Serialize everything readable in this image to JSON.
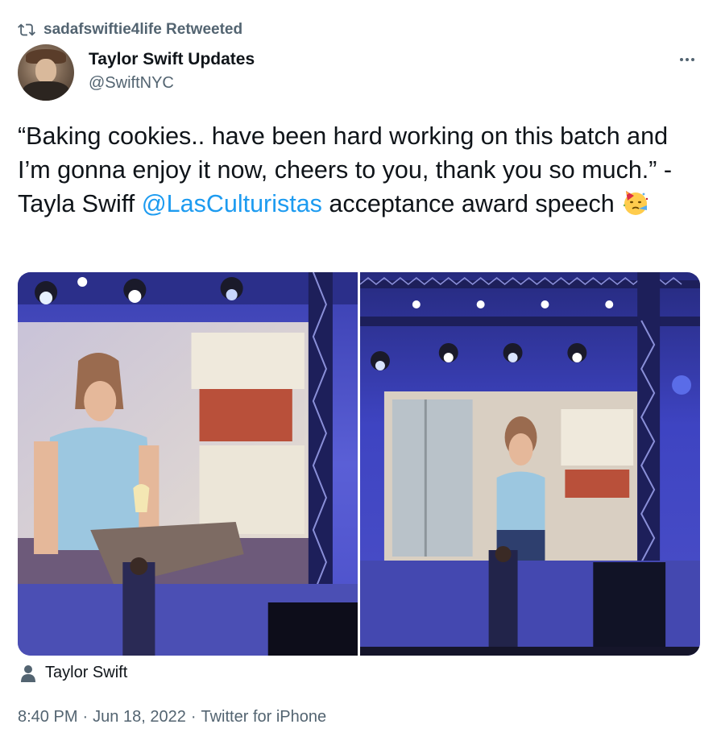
{
  "retweet": {
    "icon": "retweet-icon",
    "text": "sadafswiftie4life Retweeted"
  },
  "author": {
    "avatar_icon": "avatar",
    "name": "Taylor Swift Updates",
    "handle": "@SwiftNYC"
  },
  "more": {
    "icon": "more-horizontal-icon"
  },
  "tweet": {
    "text_before": "“Baking cookies.. have been hard working on this batch and I’m gonna enjoy it now, cheers to you, thank you so much.” - Tayla Swiff ",
    "mention": "@LasCulturistas",
    "text_after": " acceptance award speech ",
    "emoji": "partying-face-emoji"
  },
  "media": {
    "photos": [
      "photo-left",
      "photo-right"
    ]
  },
  "tagged": {
    "icon": "person-icon",
    "name": "Taylor Swift"
  },
  "meta": {
    "time": "8:40 PM",
    "sep1": "·",
    "date": "Jun 18, 2022",
    "sep2": "·",
    "source": "Twitter for iPhone"
  },
  "colors": {
    "accent": "#1d9bf0",
    "secondary_text": "#536471",
    "primary_text": "#0f1419"
  }
}
